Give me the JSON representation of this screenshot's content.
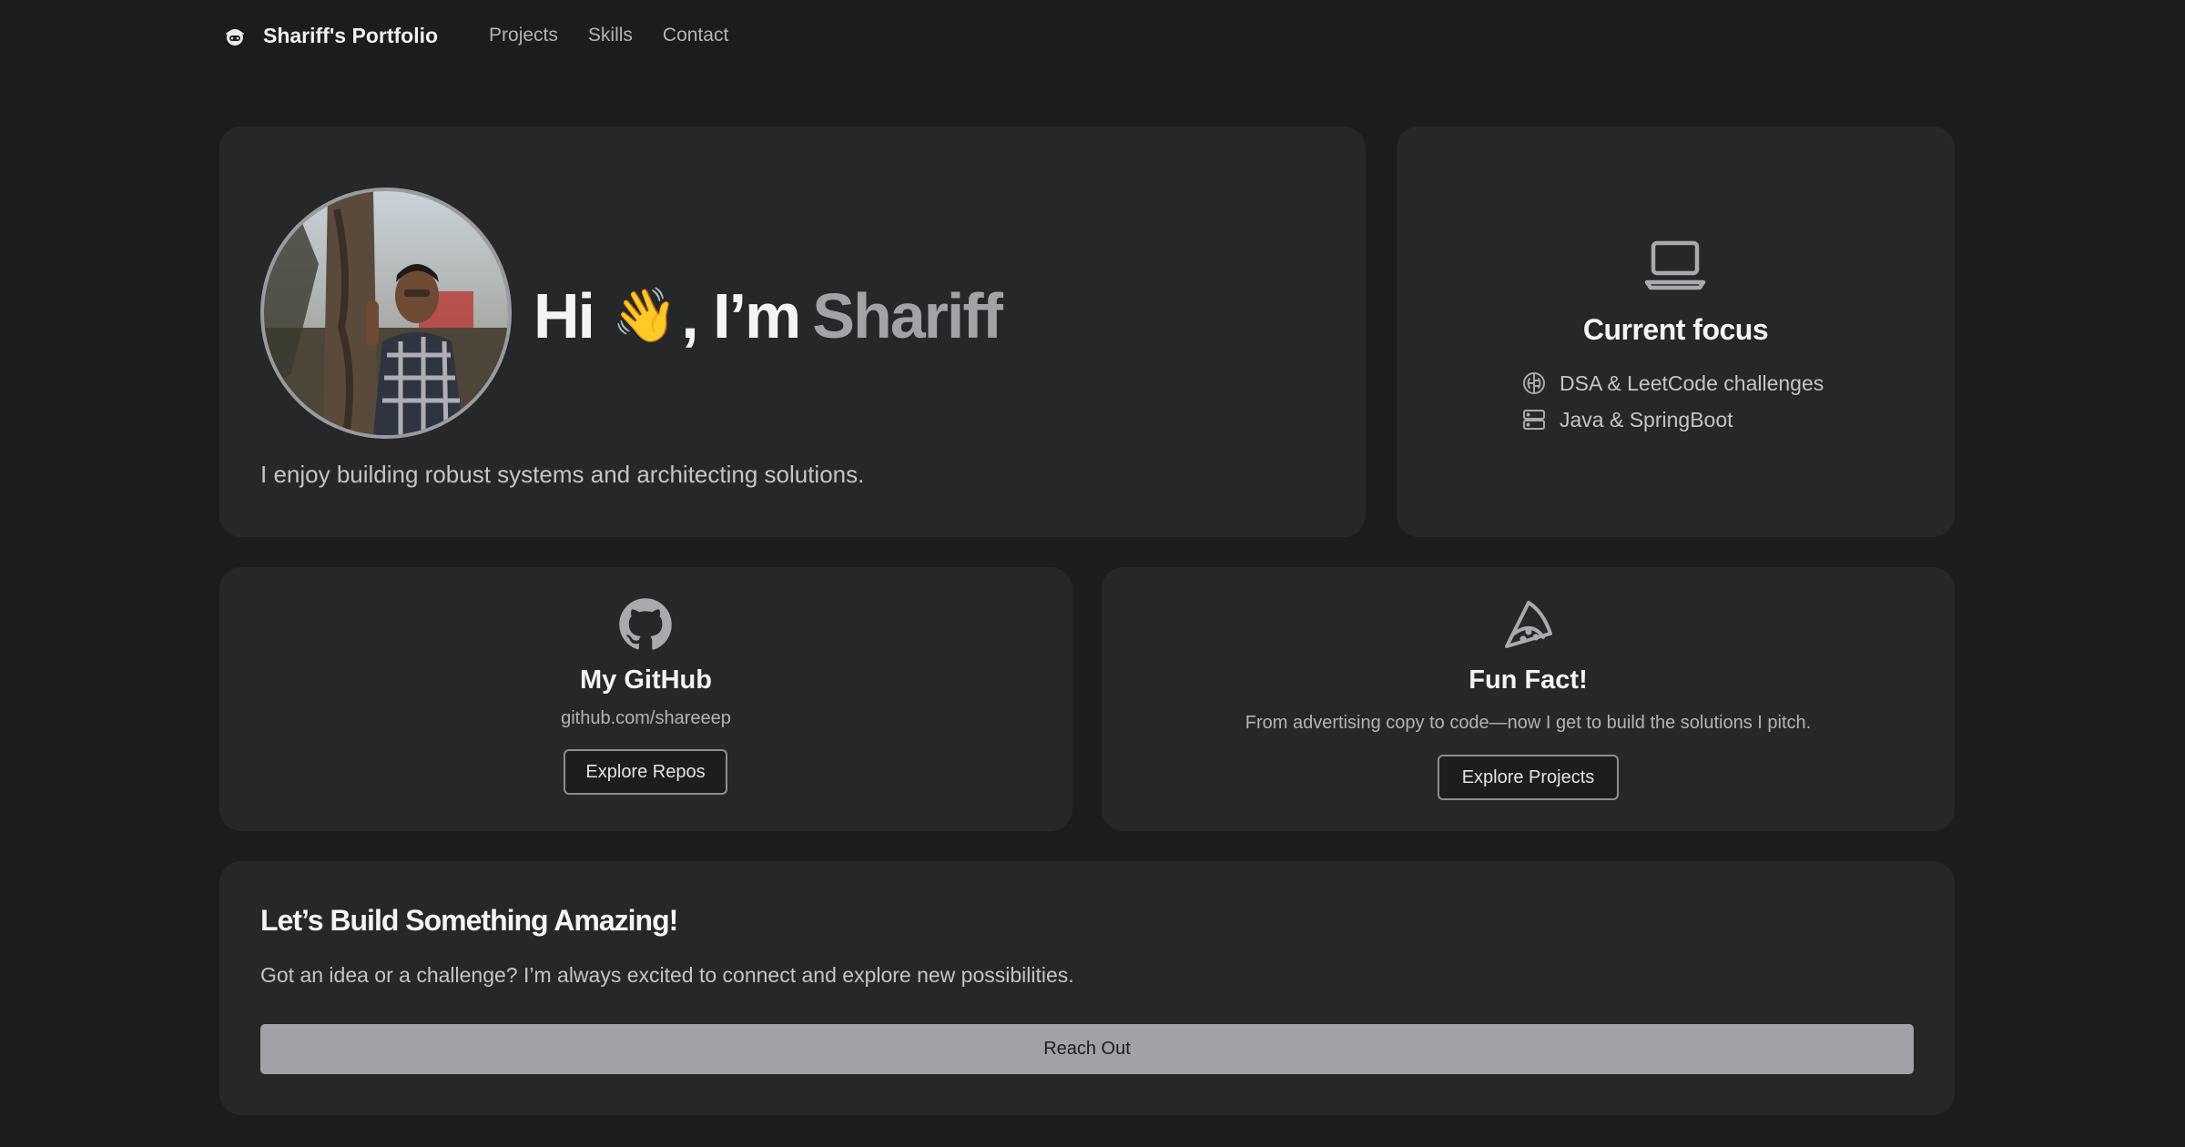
{
  "nav": {
    "brand": "Shariff's Portfolio",
    "brand_icon": "mascot-icon",
    "links": [
      "Projects",
      "Skills",
      "Contact"
    ]
  },
  "hero": {
    "greeting": "Hi",
    "wave": "👋",
    "im": ", I’m",
    "name": "Shariff",
    "subtitle": "I enjoy building robust systems and architecting solutions."
  },
  "focus": {
    "icon": "laptop-icon",
    "title": "Current focus",
    "items": [
      {
        "icon": "brain-icon",
        "label": "DSA & LeetCode challenges"
      },
      {
        "icon": "server-icon",
        "label": "Java & SpringBoot"
      }
    ]
  },
  "github": {
    "icon": "github-icon",
    "title": "My GitHub",
    "link": "github.com/shareeep",
    "button": "Explore Repos"
  },
  "funfact": {
    "icon": "pizza-icon",
    "title": "Fun Fact!",
    "text": "From advertising copy to code—now I get to build the solutions I pitch.",
    "button": "Explore Projects"
  },
  "cta": {
    "title": "Let’s Build Something Amazing!",
    "text": "Got an idea or a challenge? I’m always excited to connect and explore new possibilities.",
    "button": "Reach Out"
  },
  "colors": {
    "background": "#1b1c1e",
    "card": "#262729",
    "accent_muted": "#a2a3a7",
    "primary_button": "#a1a2a7"
  }
}
